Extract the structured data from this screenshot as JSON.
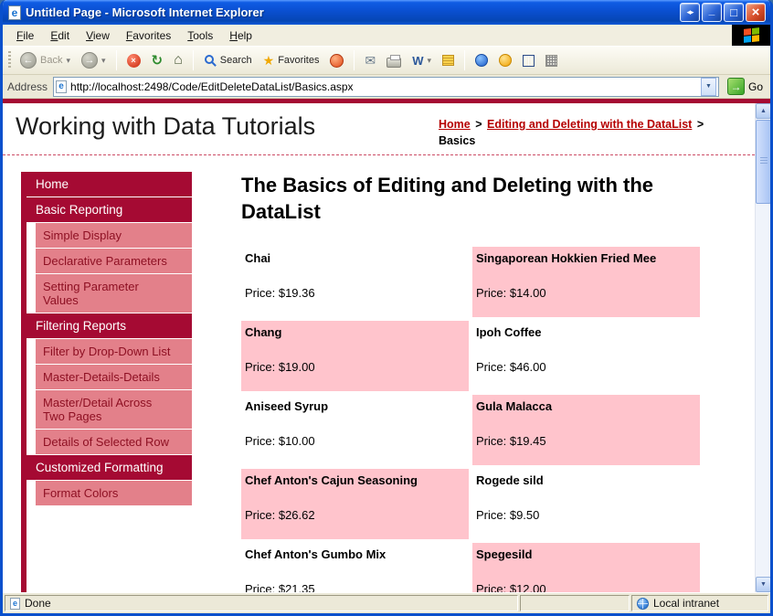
{
  "colors": {
    "maroon": "#a50a33",
    "nav_item_pink": "#e3808a",
    "datalist_pink": "#ffc4cc",
    "link_red": "#b50000",
    "titlebar_blue": "#0a4fd0"
  },
  "window": {
    "title": "Untitled Page - Microsoft Internet Explorer"
  },
  "menu_bar": {
    "items": [
      "File",
      "Edit",
      "View",
      "Favorites",
      "Tools",
      "Help"
    ]
  },
  "toolbar": {
    "back_label": "Back",
    "search_label": "Search",
    "favorites_label": "Favorites"
  },
  "address_bar": {
    "label": "Address",
    "url": "http://localhost:2498/Code/EditDeleteDataList/Basics.aspx",
    "go_label": "Go"
  },
  "page": {
    "site_title": "Working with Data Tutorials",
    "breadcrumb": {
      "home": "Home",
      "separator": ">",
      "section": "Editing and Deleting with the DataList",
      "current": "Basics"
    },
    "heading": "The Basics of Editing and Deleting with the DataList",
    "sidebar": [
      {
        "label": "Home",
        "type": "header"
      },
      {
        "label": "Basic Reporting",
        "type": "header"
      },
      {
        "label": "Simple Display",
        "type": "item"
      },
      {
        "label": "Declarative Parameters",
        "type": "item"
      },
      {
        "label": "Setting Parameter Values",
        "type": "item"
      },
      {
        "label": "Filtering Reports",
        "type": "header"
      },
      {
        "label": "Filter by Drop-Down List",
        "type": "item"
      },
      {
        "label": "Master-Details-Details",
        "type": "item"
      },
      {
        "label": "Master/Detail Across Two Pages",
        "type": "item"
      },
      {
        "label": "Details of Selected Row",
        "type": "item"
      },
      {
        "label": "Customized Formatting",
        "type": "header"
      },
      {
        "label": "Format Colors",
        "type": "item"
      }
    ],
    "products": [
      {
        "name": "Chai",
        "price_text": "Price: $19.36",
        "shade": false
      },
      {
        "name": "Singaporean Hokkien Fried Mee",
        "price_text": "Price: $14.00",
        "shade": true
      },
      {
        "name": "Chang",
        "price_text": "Price: $19.00",
        "shade": true
      },
      {
        "name": "Ipoh Coffee",
        "price_text": "Price: $46.00",
        "shade": false
      },
      {
        "name": "Aniseed Syrup",
        "price_text": "Price: $10.00",
        "shade": false
      },
      {
        "name": "Gula Malacca",
        "price_text": "Price: $19.45",
        "shade": true
      },
      {
        "name": "Chef Anton's Cajun Seasoning",
        "price_text": "Price: $26.62",
        "shade": true
      },
      {
        "name": "Rogede sild",
        "price_text": "Price: $9.50",
        "shade": false
      },
      {
        "name": "Chef Anton's Gumbo Mix",
        "price_text": "Price: $21.35",
        "shade": false
      },
      {
        "name": "Spegesild",
        "price_text": "Price: $12.00",
        "shade": true
      }
    ]
  },
  "status_bar": {
    "status": "Done",
    "zone": "Local intranet"
  }
}
